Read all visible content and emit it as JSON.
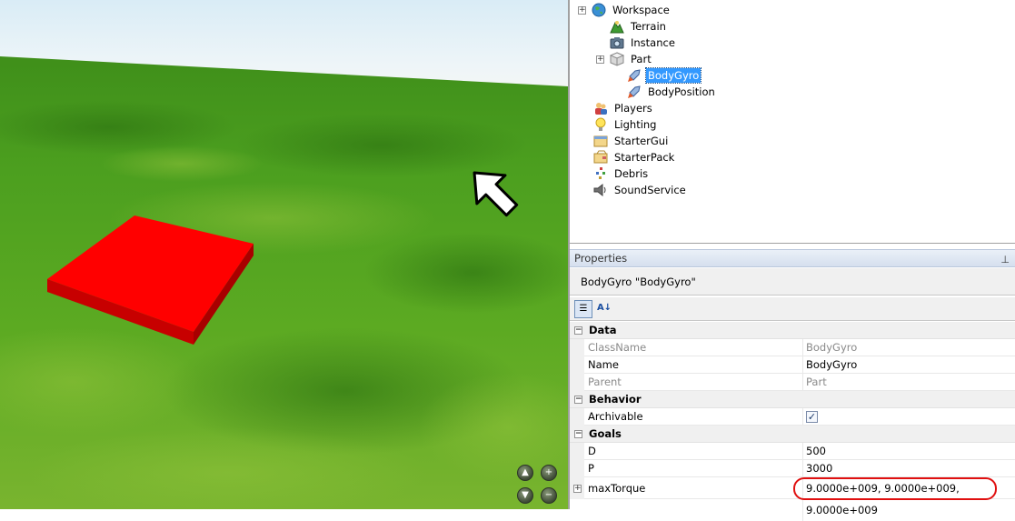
{
  "explorer": {
    "items": [
      {
        "label": "Workspace",
        "icon": "workspace-globe-icon",
        "expander": "+"
      },
      {
        "label": "Terrain",
        "icon": "terrain-icon"
      },
      {
        "label": "Instance",
        "icon": "instance-camera-icon"
      },
      {
        "label": "Part",
        "icon": "part-brick-icon",
        "expander": "+"
      },
      {
        "label": "BodyGyro",
        "icon": "bodymover-rocket-icon",
        "selected": true
      },
      {
        "label": "BodyPosition",
        "icon": "bodymover-rocket-icon"
      },
      {
        "label": "Players",
        "icon": "players-icon"
      },
      {
        "label": "Lighting",
        "icon": "lightbulb-icon"
      },
      {
        "label": "StarterGui",
        "icon": "startergui-icon"
      },
      {
        "label": "StarterPack",
        "icon": "starterpack-icon"
      },
      {
        "label": "Debris",
        "icon": "debris-icon"
      },
      {
        "label": "SoundService",
        "icon": "speaker-icon"
      }
    ]
  },
  "properties": {
    "panel_title": "Properties",
    "object_title": "BodyGyro \"BodyGyro\"",
    "categories": [
      {
        "name": "Data",
        "expander": "−",
        "props": [
          {
            "name": "ClassName",
            "value": "BodyGyro",
            "readonly": true
          },
          {
            "name": "Name",
            "value": "BodyGyro"
          },
          {
            "name": "Parent",
            "value": "Part",
            "readonly": true
          }
        ]
      },
      {
        "name": "Behavior",
        "expander": "−",
        "props": [
          {
            "name": "Archivable",
            "checkbox": true,
            "checked": true
          }
        ]
      },
      {
        "name": "Goals",
        "expander": "−",
        "props": [
          {
            "name": "D",
            "value": "500"
          },
          {
            "name": "P",
            "value": "3000"
          },
          {
            "name": "maxTorque",
            "value": "9.0000e+009, 9.0000e+009, 9.0000e+009",
            "expander": "+",
            "highlighted": true
          }
        ]
      }
    ]
  },
  "viewport": {
    "part_color": "#ff0000",
    "camera_controls": [
      "▲",
      "+",
      "▼",
      "−"
    ]
  },
  "colors": {
    "selection": "#3399ff",
    "highlight": "#e01010"
  }
}
